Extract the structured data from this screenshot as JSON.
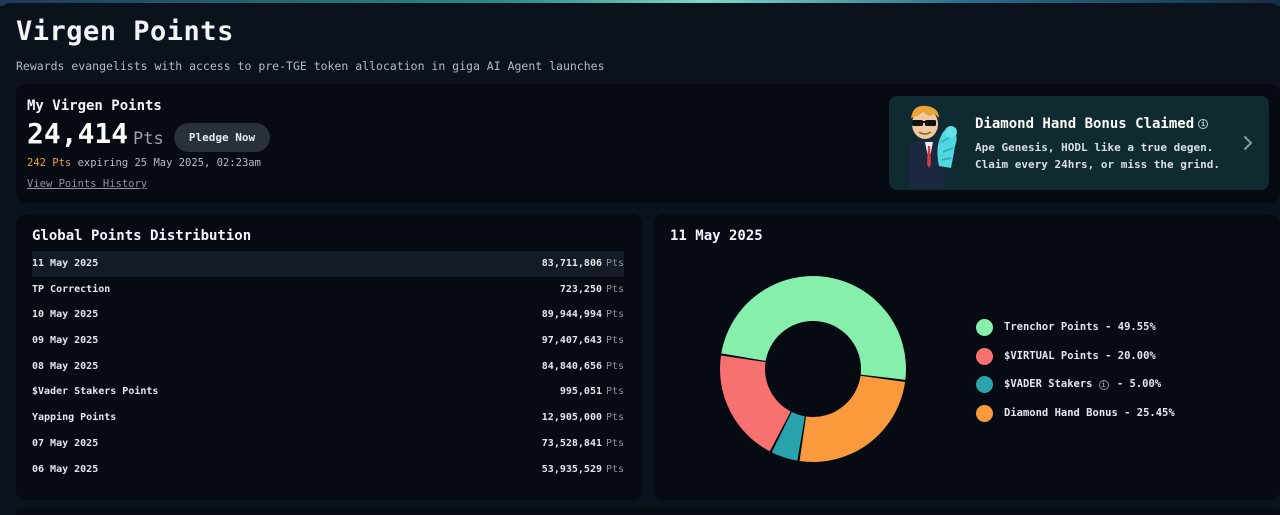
{
  "header": {
    "title": "Virgen Points",
    "subtitle": "Rewards evangelists with access to pre-TGE token allocation in giga AI Agent launches"
  },
  "my_points": {
    "label": "My Virgen Points",
    "value": "24,414",
    "unit": "Pts",
    "pledge_label": "Pledge Now",
    "expiring_amount": "242 Pts",
    "expiring_text": " expiring 25 May 2025, 02:23am",
    "history_link": "View Points History"
  },
  "bonus": {
    "title": "Diamond Hand Bonus Claimed",
    "line1": "Ape Genesis, HODL like a true degen.",
    "line2": "Claim every 24hrs, or miss the grind.",
    "info_icon": "info-icon",
    "chevron_icon": "chevron-right-icon",
    "avatar_icon": "flexing-mascot-avatar"
  },
  "distribution": {
    "title": "Global Points Distribution",
    "unit": "Pts",
    "rows": [
      {
        "label": "11 May 2025",
        "value": "83,711,806"
      },
      {
        "label": "TP Correction",
        "value": "723,250"
      },
      {
        "label": "10 May 2025",
        "value": "89,944,994"
      },
      {
        "label": "09 May 2025",
        "value": "97,407,643"
      },
      {
        "label": "08 May 2025",
        "value": "84,840,656"
      },
      {
        "label": "$Vader Stakers Points",
        "value": "995,051"
      },
      {
        "label": "Yapping Points",
        "value": "12,905,000"
      },
      {
        "label": "07 May 2025",
        "value": "73,528,841"
      },
      {
        "label": "06 May 2025",
        "value": "53,935,529"
      }
    ]
  },
  "chart": {
    "title": "11 May 2025"
  },
  "chart_data": {
    "type": "pie",
    "donut": true,
    "title": "11 May 2025",
    "slices": [
      {
        "name": "Trenchor Points",
        "value": 49.55,
        "color": "#86efac",
        "legend": "Trenchor Points - 49.55%"
      },
      {
        "name": "Diamond Hand Bonus",
        "value": 25.45,
        "color": "#fb9a3c",
        "legend": "Diamond Hand Bonus - 25.45%"
      },
      {
        "name": "$VADER Stakers",
        "value": 5.0,
        "color": "#2aa3ad",
        "legend": "$VADER Stakers",
        "legend_suffix": " - 5.00%"
      },
      {
        "name": "$VIRTUAL Points",
        "value": 20.0,
        "color": "#f87171",
        "legend": "$VIRTUAL Points - 20.00%"
      }
    ],
    "legend_order": [
      "Trenchor Points",
      "$VIRTUAL Points",
      "$VADER Stakers",
      "Diamond Hand Bonus"
    ],
    "legend_position": "right"
  }
}
